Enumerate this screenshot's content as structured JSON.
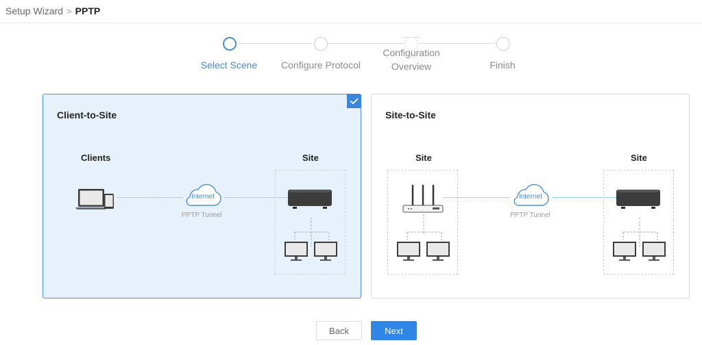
{
  "breadcrumb": {
    "parent": "Setup Wizard",
    "separator": ">",
    "current": "PPTP"
  },
  "stepper": {
    "steps": [
      {
        "label": "Select Scene",
        "active": true
      },
      {
        "label": "Configure Protocol",
        "active": false
      },
      {
        "label_line1": "Configuration",
        "label_line2": "Overview",
        "active": false
      },
      {
        "label": "Finish",
        "active": false
      }
    ]
  },
  "cards": {
    "client_to_site": {
      "title": "Client-to-Site",
      "selected": true,
      "left_label": "Clients",
      "right_label": "Site",
      "cloud_text": "Internet",
      "tunnel_label": "PPTP Tunnel"
    },
    "site_to_site": {
      "title": "Site-to-Site",
      "selected": false,
      "left_label": "Site",
      "right_label": "Site",
      "cloud_text": "Internet",
      "tunnel_label": "PPTP Tunnel"
    }
  },
  "buttons": {
    "back": "Back",
    "next": "Next"
  },
  "colors": {
    "accent": "#2f86e6",
    "selected_bg": "#e7f1fc",
    "step_active": "#3d8ad8"
  }
}
